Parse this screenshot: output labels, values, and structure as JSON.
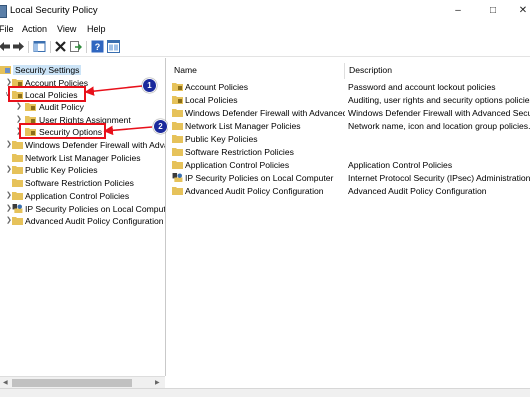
{
  "window": {
    "title": "Local Security Policy",
    "controls": [
      "–",
      "□",
      "✕"
    ]
  },
  "menu": [
    "File",
    "Action",
    "View",
    "Help"
  ],
  "toolbar": [
    "back-icon",
    "forward-icon",
    "show-tree-icon",
    "delete-icon",
    "export-icon",
    "help-icon",
    "properties-icon"
  ],
  "tree": {
    "root": "Security Settings",
    "items": [
      {
        "label": "Account Policies"
      },
      {
        "label": "Local Policies"
      },
      {
        "label": "Audit Policy"
      },
      {
        "label": "User Rights Assignment"
      },
      {
        "label": "Security Options"
      },
      {
        "label": "Windows Defender Firewall with Advanced Security"
      },
      {
        "label": "Network List Manager Policies"
      },
      {
        "label": "Public Key Policies"
      },
      {
        "label": "Software Restriction Policies"
      },
      {
        "label": "Application Control Policies"
      },
      {
        "label": "IP Security Policies on Local Computer"
      },
      {
        "label": "Advanced Audit Policy Configuration"
      }
    ]
  },
  "list": {
    "columns": {
      "name": "Name",
      "description": "Description"
    },
    "rows": [
      {
        "name": "Account Policies",
        "description": "Password and account lockout policies"
      },
      {
        "name": "Local Policies",
        "description": "Auditing, user rights and security options policies"
      },
      {
        "name": "Windows Defender Firewall with Advanced Security",
        "description": "Windows Defender Firewall with Advanced Security"
      },
      {
        "name": "Network List Manager Policies",
        "description": "Network name, icon and location group policies."
      },
      {
        "name": "Public Key Policies",
        "description": ""
      },
      {
        "name": "Software Restriction Policies",
        "description": ""
      },
      {
        "name": "Application Control Policies",
        "description": "Application Control Policies"
      },
      {
        "name": "IP Security Policies on Local Computer",
        "description": "Internet Protocol Security (IPsec) Administration"
      },
      {
        "name": "Advanced Audit Policy Configuration",
        "description": "Advanced Audit Policy Configuration"
      }
    ]
  },
  "callouts": [
    "1",
    "2"
  ],
  "colors": {
    "highlight": "#e8101a",
    "callout": "#1b2a9c",
    "folder": "#e6c25a"
  }
}
